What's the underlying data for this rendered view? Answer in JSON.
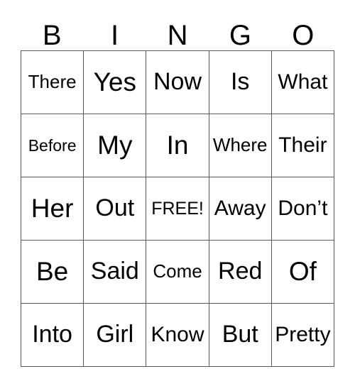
{
  "card": {
    "headers": [
      "B",
      "I",
      "N",
      "G",
      "O"
    ],
    "free_space_label": "FREE!",
    "colors": {
      "background": "#ffffff",
      "text": "#000000",
      "grid_line": "#595959"
    },
    "rows": [
      [
        {
          "text": "There",
          "size": "s-sm"
        },
        {
          "text": "Yes",
          "size": "s-xl"
        },
        {
          "text": "Now",
          "size": "s-lg"
        },
        {
          "text": "Is",
          "size": "s-lg"
        },
        {
          "text": "What",
          "size": "s-md"
        }
      ],
      [
        {
          "text": "Before",
          "size": "s-xs"
        },
        {
          "text": "My",
          "size": "s-xl"
        },
        {
          "text": "In",
          "size": "s-xl"
        },
        {
          "text": "Where",
          "size": "s-sm"
        },
        {
          "text": "Their",
          "size": "s-md"
        }
      ],
      [
        {
          "text": "Her",
          "size": "s-xl"
        },
        {
          "text": "Out",
          "size": "s-lg"
        },
        {
          "text": "FREE!",
          "size": "s-free"
        },
        {
          "text": "Away",
          "size": "s-md"
        },
        {
          "text": "Don’t",
          "size": "s-md"
        }
      ],
      [
        {
          "text": "Be",
          "size": "s-xl"
        },
        {
          "text": "Said",
          "size": "s-lg"
        },
        {
          "text": "Come",
          "size": "s-sm"
        },
        {
          "text": "Red",
          "size": "s-lg"
        },
        {
          "text": "Of",
          "size": "s-xl"
        }
      ],
      [
        {
          "text": "Into",
          "size": "s-lg"
        },
        {
          "text": "Girl",
          "size": "s-lg"
        },
        {
          "text": "Know",
          "size": "s-md"
        },
        {
          "text": "But",
          "size": "s-lg"
        },
        {
          "text": "Pretty",
          "size": "s-md"
        }
      ]
    ]
  }
}
